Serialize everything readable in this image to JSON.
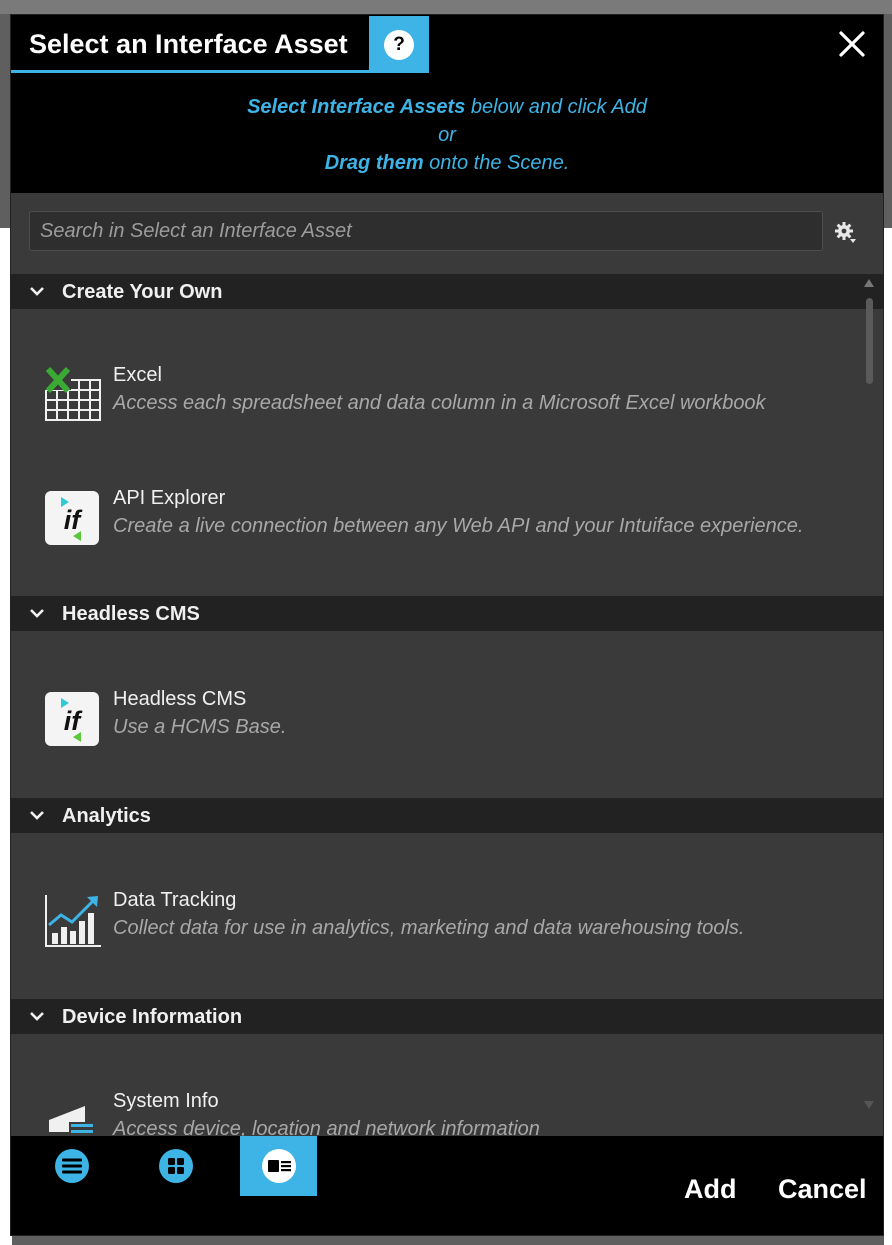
{
  "dialog": {
    "title": "Select an Interface Asset",
    "help_symbol": "?",
    "accent_color": "#3eb3e6"
  },
  "instructions": {
    "line1_bold": "Select Interface Assets",
    "line1_rest": " below and click Add",
    "line2": "or",
    "line3_bold": "Drag them",
    "line3_rest": " onto the Scene."
  },
  "search": {
    "placeholder": "Search in Select an Interface Asset",
    "value": ""
  },
  "sections": [
    {
      "label": "Create Your Own",
      "items": [
        {
          "name": "Excel",
          "description": "Access each spreadsheet and data column in a Microsoft Excel workbook",
          "icon": "excel-icon"
        },
        {
          "name": "API Explorer",
          "description": "Create a live connection between any Web API and your Intuiface experience.",
          "icon": "intuiface-icon"
        }
      ]
    },
    {
      "label": "Headless CMS",
      "items": [
        {
          "name": "Headless CMS",
          "description": "Use a HCMS Base.",
          "icon": "intuiface-icon"
        }
      ]
    },
    {
      "label": "Analytics",
      "items": [
        {
          "name": "Data Tracking",
          "description": "Collect data for use in analytics, marketing and data warehousing tools.",
          "icon": "chart-icon"
        }
      ]
    },
    {
      "label": "Device Information",
      "items": [
        {
          "name": "System Info",
          "description": "Access device, location and network information",
          "icon": "system-info-icon"
        }
      ]
    }
  ],
  "footer": {
    "view_modes": [
      "list-view",
      "grid-view",
      "detail-view"
    ],
    "active_view": "detail-view",
    "add_label": "Add",
    "cancel_label": "Cancel"
  }
}
